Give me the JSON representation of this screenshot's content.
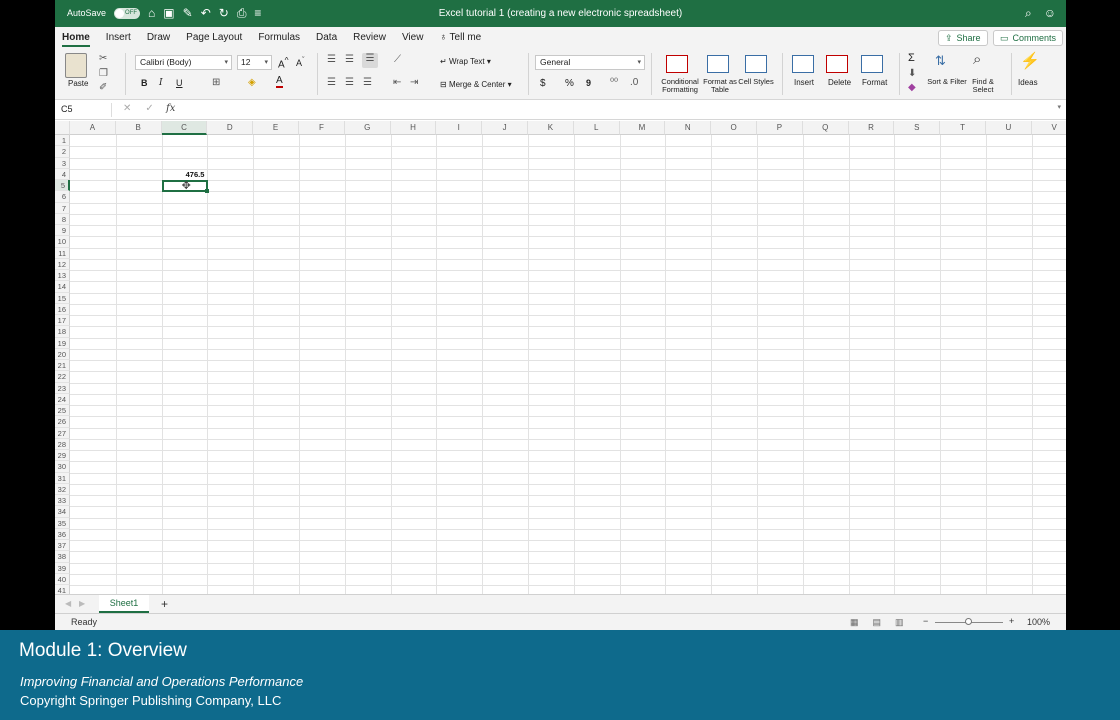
{
  "titlebar": {
    "autosave_label": "AutoSave",
    "autosave_state": "OFF",
    "doc_title": "Excel tutorial 1 (creating a new electronic spreadsheet)"
  },
  "tabs": [
    "Home",
    "Insert",
    "Draw",
    "Page Layout",
    "Formulas",
    "Data",
    "Review",
    "View"
  ],
  "active_tab": "Home",
  "tell_me": "Tell me",
  "share_label": "Share",
  "comments_label": "Comments",
  "ribbon": {
    "paste_label": "Paste",
    "font_name": "Calibri (Body)",
    "font_size": "12",
    "bold": "B",
    "italic": "I",
    "underline": "U",
    "wrap_text": "Wrap Text",
    "merge_center": "Merge & Center",
    "number_format": "General",
    "currency": "$",
    "percent": "%",
    "comma": "9",
    "conditional_formatting": "Conditional Formatting",
    "format_as_table": "Format as Table",
    "cell_styles": "Cell Styles",
    "insert": "Insert",
    "delete": "Delete",
    "format": "Format",
    "sort_filter": "Sort & Filter",
    "find_select": "Find & Select",
    "ideas": "Ideas"
  },
  "formula_bar": {
    "name_box": "C5",
    "fx": "fx",
    "content": ""
  },
  "grid": {
    "columns": [
      "A",
      "B",
      "C",
      "D",
      "E",
      "F",
      "G",
      "H",
      "I",
      "J",
      "K",
      "L",
      "M",
      "N",
      "O",
      "P",
      "Q",
      "R",
      "S",
      "T",
      "U",
      "V"
    ],
    "rows": [
      "1",
      "2",
      "3",
      "4",
      "5",
      "6",
      "7",
      "8",
      "9",
      "10",
      "11",
      "12",
      "13",
      "14",
      "15",
      "16",
      "17",
      "18",
      "19",
      "20",
      "21",
      "22",
      "23",
      "24",
      "25",
      "26",
      "27",
      "28",
      "29",
      "30",
      "31",
      "32",
      "33",
      "34",
      "35",
      "36",
      "37",
      "38",
      "39",
      "40",
      "41"
    ],
    "cells": [
      {
        "ref": "C4",
        "col": 2,
        "row": 3,
        "value": "476.5"
      }
    ],
    "selected_cell": {
      "ref": "C5",
      "col": 2,
      "row": 4
    }
  },
  "sheet_tabs": [
    "Sheet1"
  ],
  "add_sheet": "+",
  "status": {
    "text": "Ready",
    "zoom": "100%",
    "zoom_minus": "−",
    "zoom_plus": "+"
  },
  "caption": {
    "title": "Module 1: Overview",
    "subtitle": "Improving Financial and Operations Performance",
    "copyright": "Copyright Springer Publishing Company, LLC"
  },
  "colors": {
    "excel_green": "#1f6f43",
    "caption_bg": "#0e6a8c"
  }
}
